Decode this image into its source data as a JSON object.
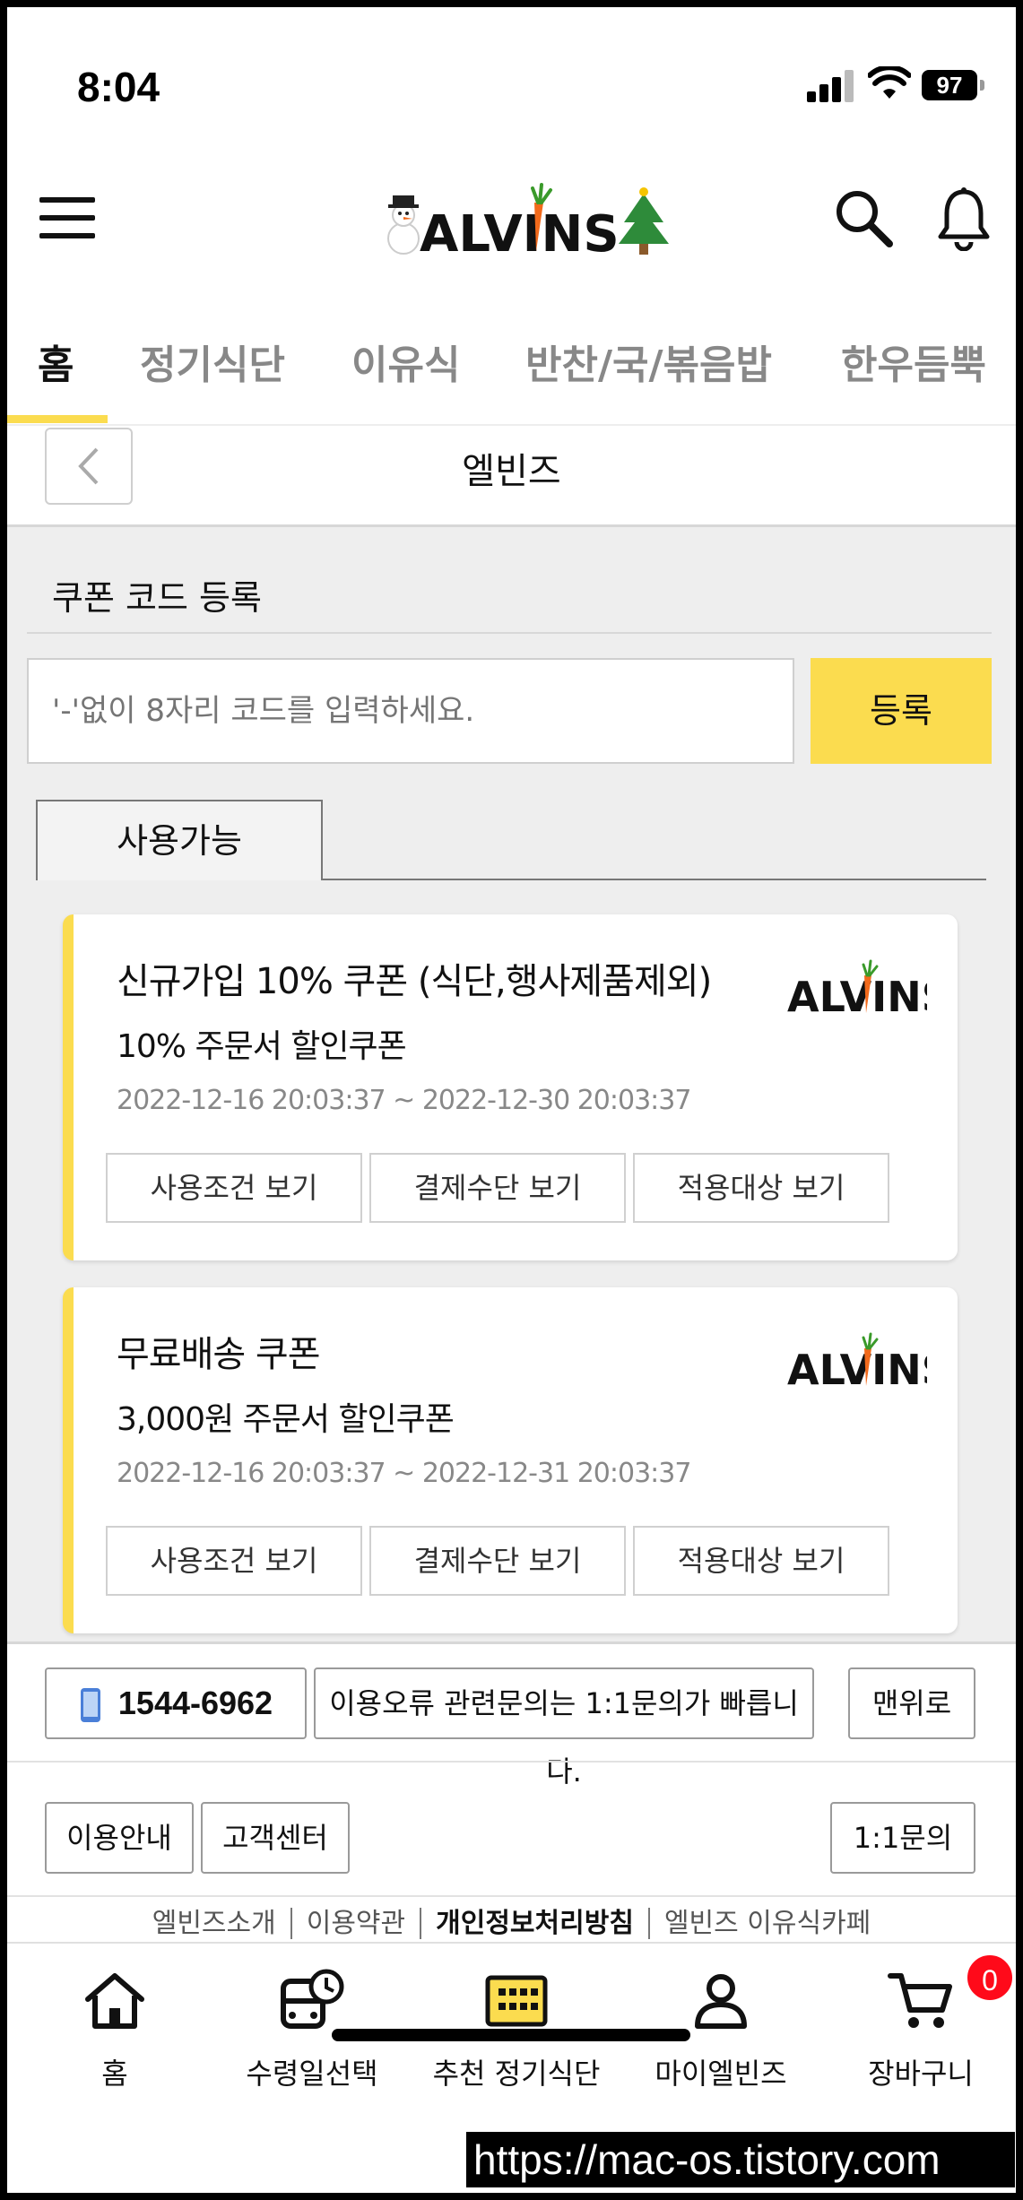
{
  "status_bar": {
    "time": "8:04",
    "battery": "97"
  },
  "header": {
    "brand": "ALVINS"
  },
  "category_tabs": [
    {
      "label": "홈"
    },
    {
      "label": "정기식단"
    },
    {
      "label": "이유식"
    },
    {
      "label": "반찬/국/볶음밥"
    },
    {
      "label": "한우듬뿍"
    }
  ],
  "subheader": {
    "title": "엘빈즈"
  },
  "coupon": {
    "section_title": "쿠폰 코드 등록",
    "input_placeholder": "'-'없이 8자리 코드를 입력하세요.",
    "register_label": "등록",
    "tab_label": "사용가능",
    "cards": [
      {
        "title": "신규가입 10% 쿠폰 (식단,행사제품제외)",
        "subtitle": "10% 주문서 할인쿠폰",
        "period": "2022-12-16 20:03:37 ~ 2022-12-30 20:03:37",
        "logo": "ALVINS",
        "buttons": [
          "사용조건 보기",
          "결제수단 보기",
          "적용대상 보기"
        ]
      },
      {
        "title": "무료배송 쿠폰",
        "subtitle": "3,000원 주문서 할인쿠폰",
        "period": "2022-12-16 20:03:37 ~ 2022-12-31 20:03:37",
        "logo": "ALVINS",
        "buttons": [
          "사용조건 보기",
          "결제수단 보기",
          "적용대상 보기"
        ]
      }
    ]
  },
  "footer": {
    "phone": "1544-6962",
    "inquiry_note": "이용오류 관련문의는 1:1문의가 빠릅니다.",
    "top_label": "맨위로",
    "guide_label": "이용안내",
    "cs_label": "고객센터",
    "qa_label": "1:1문의",
    "links": [
      "엘빈즈소개",
      "이용약관",
      "개인정보처리방침",
      "엘빈즈 이유식카페"
    ]
  },
  "bottom_nav": [
    {
      "label": "홈"
    },
    {
      "label": "수령일선택"
    },
    {
      "label": "추천 정기식단"
    },
    {
      "label": "마이엘빈즈"
    },
    {
      "label": "장바구니",
      "badge": "0"
    }
  ],
  "watermark": "https://mac-os.tistory.com",
  "colors": {
    "accent": "#fbdc4f",
    "badge": "#ff0a1a",
    "carrot": "#f26a1b"
  }
}
